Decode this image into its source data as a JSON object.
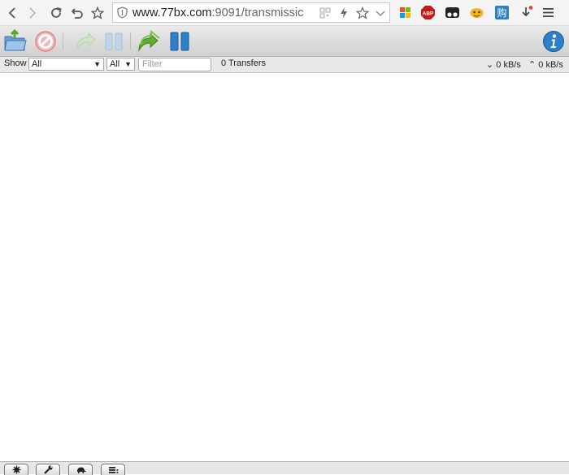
{
  "browser": {
    "url_host": "www.77bx.com",
    "url_rest": ":9091/transmissic",
    "extensions": [
      "colored-grid-icon",
      "abp-icon",
      "tampermonkey-icon",
      "monkey-icon",
      "gou-icon",
      "download-icon",
      "menu-icon"
    ],
    "abp_label": "ABP",
    "gou_label": "购"
  },
  "filterbar": {
    "show_label": "Show",
    "state_filter": "All",
    "tracker_filter": "All",
    "filter_placeholder": "Filter",
    "transfers": "0 Transfers",
    "download_speed": "0 kB/s",
    "upload_speed": "0 kB/s"
  },
  "toolbar": {
    "buttons": [
      "open-torrent-icon",
      "remove-torrent-icon",
      "resume-torrent-icon",
      "pause-torrent-icon",
      "resume-all-icon",
      "pause-all-icon",
      "info-icon"
    ]
  },
  "bottombar": {
    "buttons": [
      "settings-icon",
      "wrench-icon",
      "turtle-icon",
      "sort-icon"
    ]
  },
  "colors": {
    "toolbar_top": "#ebebeb",
    "toolbar_bottom": "#d0d0d0",
    "accent_blue": "#2d7fc8",
    "accent_green": "#5fae2d",
    "remove_red": "#e08a8a"
  }
}
